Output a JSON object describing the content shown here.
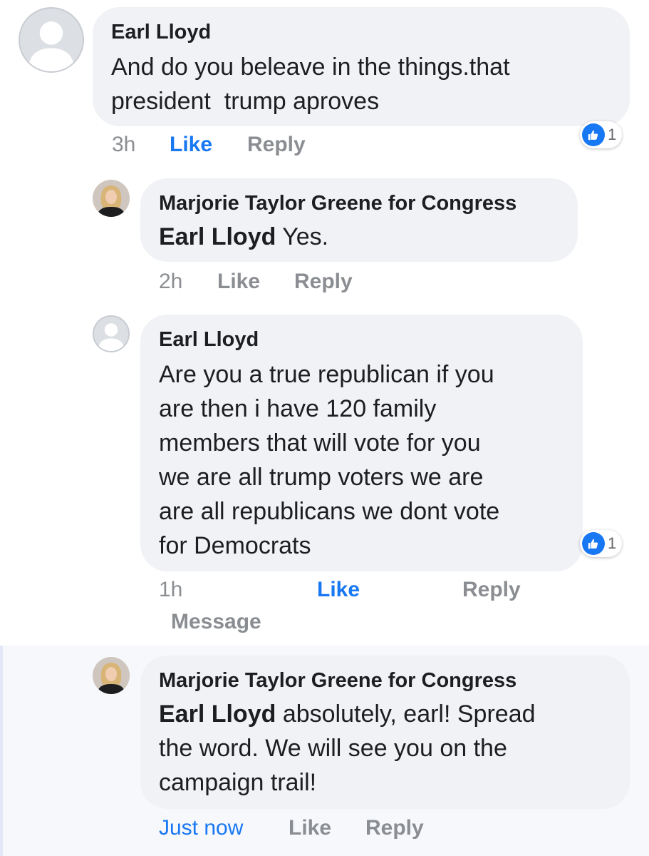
{
  "comments": [
    {
      "author": "Earl Lloyd",
      "text": "And do you beleave in the things.that\npresident  trump aproves",
      "time": "3h",
      "like_label": "Like",
      "reply_label": "Reply",
      "reaction_count": "1",
      "reaction_icon": "thumbs-up-icon"
    },
    {
      "author": "Marjorie Taylor Greene for Congress",
      "mention": "Earl Lloyd",
      "text": " Yes.",
      "time": "2h",
      "like_label": "Like",
      "reply_label": "Reply"
    },
    {
      "author": "Earl Lloyd",
      "text": "Are you a true republican if you\nare then i have 120 family\nmembers that will vote for you\nwe are all trump voters we are\nare all republicans we dont vote\nfor Democrats",
      "time": "1h",
      "like_label": "Like",
      "reply_label": "Reply",
      "message_label": "Message",
      "reaction_count": "1",
      "reaction_icon": "thumbs-up-icon"
    },
    {
      "author": "Marjorie Taylor Greene for Congress",
      "mention": "Earl Lloyd",
      "text": " absolutely, earl! Spread\nthe word. We will see you on the\ncampaign trail!",
      "time": "Just now",
      "like_label": "Like",
      "reply_label": "Reply"
    }
  ],
  "colors": {
    "bubble": "#f0f2f5",
    "action_gray": "#8a8d91",
    "link_blue": "#1877f2",
    "highlight": "#f7f8fc"
  }
}
